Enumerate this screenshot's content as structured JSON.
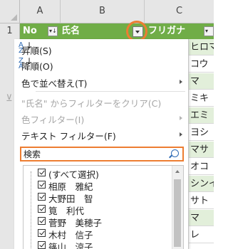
{
  "columns": {
    "a": "A",
    "b": "B",
    "c": "C"
  },
  "rows": {
    "r1": "1"
  },
  "header": {
    "col_no": "No",
    "col_name": "氏名",
    "col_kana": "フリガナ"
  },
  "side_cells": [
    "ヒロマ",
    "コウ",
    "マ",
    "ミキ",
    "エミ",
    "ヨシ",
    "マサ",
    "オコ",
    "シンイ",
    "サト",
    "マ",
    "レ"
  ],
  "menu": {
    "sort_asc": "昇順(S)",
    "sort_desc": "降順(O)",
    "sort_by_color": "色で並べ替え(T)",
    "clear_filter": "\"氏名\" からフィルターをクリア(C)",
    "color_filter": "色フィルター(I)",
    "text_filter": "テキスト フィルター(F)"
  },
  "search": {
    "placeholder": "検索"
  },
  "list_items": [
    "(すべて選択)",
    "相原　雅紀",
    "大野田　智",
    "筧　利代",
    "菅野　美穂子",
    "木村　信子",
    "篠山　涼子"
  ],
  "colors": {
    "accent": "#ed7d31",
    "header_green": "#70ad47",
    "band_green": "#e2efda",
    "icon_blue": "#2e6bb5"
  }
}
